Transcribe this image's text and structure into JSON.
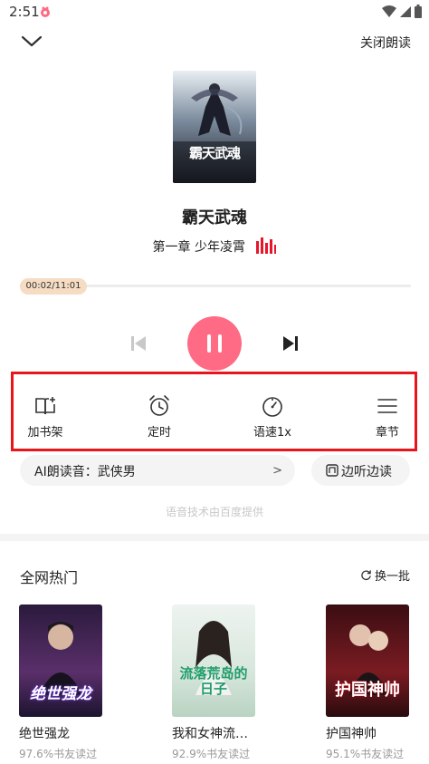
{
  "status_bar": {
    "time": "2:51"
  },
  "header": {
    "close_label": "关闭朗读"
  },
  "book": {
    "title": "霸天武魂",
    "chapter": "第一章 少年凌霄",
    "cover_title": "霸天武魂"
  },
  "player": {
    "time_label": "00:02/11:01",
    "progress_fraction": 0.003
  },
  "toolbar": {
    "items": [
      {
        "label": "加书架",
        "icon": "add-bookshelf-icon"
      },
      {
        "label": "定时",
        "icon": "alarm-clock-icon"
      },
      {
        "label": "语速1x",
        "icon": "speedometer-icon"
      },
      {
        "label": "章节",
        "icon": "menu-lines-icon"
      }
    ],
    "highlight_color": "#e8161c"
  },
  "voice": {
    "label": "AI朗读音：武侠男",
    "listen_label": "边听边读",
    "credit": "语音技术由百度提供"
  },
  "hot": {
    "title": "全网热门",
    "refresh_label": "换一批",
    "books": [
      {
        "name": "绝世强龙",
        "stat": "97.6%书友读过",
        "cover_text": "绝世强龙"
      },
      {
        "name": "我和女神流…",
        "stat": "92.9%书友读过",
        "cover_text": "流落荒岛的日子"
      },
      {
        "name": "护国神帅",
        "stat": "95.1%书友读过",
        "cover_text": "护国神帅"
      }
    ]
  },
  "colors": {
    "accent": "#ff6a84",
    "progress_pill": "#f6dcc3"
  }
}
